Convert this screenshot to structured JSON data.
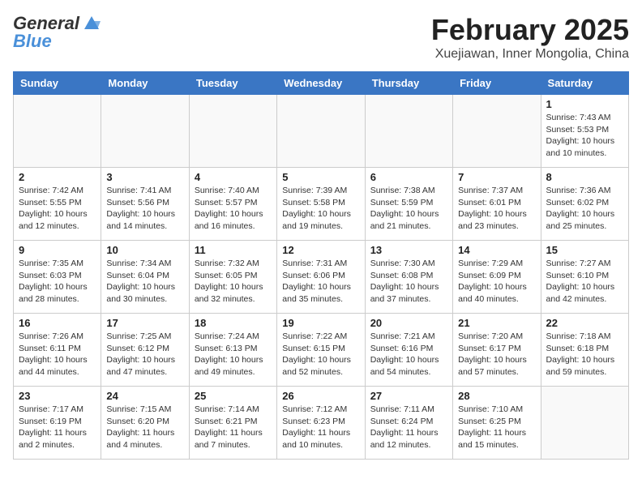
{
  "header": {
    "logo_general": "General",
    "logo_blue": "Blue",
    "title": "February 2025",
    "subtitle": "Xuejiawan, Inner Mongolia, China"
  },
  "weekdays": [
    "Sunday",
    "Monday",
    "Tuesday",
    "Wednesday",
    "Thursday",
    "Friday",
    "Saturday"
  ],
  "days": [
    {
      "num": "",
      "info": ""
    },
    {
      "num": "",
      "info": ""
    },
    {
      "num": "",
      "info": ""
    },
    {
      "num": "",
      "info": ""
    },
    {
      "num": "",
      "info": ""
    },
    {
      "num": "",
      "info": ""
    },
    {
      "num": "1",
      "info": "Sunrise: 7:43 AM\nSunset: 5:53 PM\nDaylight: 10 hours and 10 minutes."
    }
  ],
  "week2": [
    {
      "num": "2",
      "info": "Sunrise: 7:42 AM\nSunset: 5:55 PM\nDaylight: 10 hours and 12 minutes."
    },
    {
      "num": "3",
      "info": "Sunrise: 7:41 AM\nSunset: 5:56 PM\nDaylight: 10 hours and 14 minutes."
    },
    {
      "num": "4",
      "info": "Sunrise: 7:40 AM\nSunset: 5:57 PM\nDaylight: 10 hours and 16 minutes."
    },
    {
      "num": "5",
      "info": "Sunrise: 7:39 AM\nSunset: 5:58 PM\nDaylight: 10 hours and 19 minutes."
    },
    {
      "num": "6",
      "info": "Sunrise: 7:38 AM\nSunset: 5:59 PM\nDaylight: 10 hours and 21 minutes."
    },
    {
      "num": "7",
      "info": "Sunrise: 7:37 AM\nSunset: 6:01 PM\nDaylight: 10 hours and 23 minutes."
    },
    {
      "num": "8",
      "info": "Sunrise: 7:36 AM\nSunset: 6:02 PM\nDaylight: 10 hours and 25 minutes."
    }
  ],
  "week3": [
    {
      "num": "9",
      "info": "Sunrise: 7:35 AM\nSunset: 6:03 PM\nDaylight: 10 hours and 28 minutes."
    },
    {
      "num": "10",
      "info": "Sunrise: 7:34 AM\nSunset: 6:04 PM\nDaylight: 10 hours and 30 minutes."
    },
    {
      "num": "11",
      "info": "Sunrise: 7:32 AM\nSunset: 6:05 PM\nDaylight: 10 hours and 32 minutes."
    },
    {
      "num": "12",
      "info": "Sunrise: 7:31 AM\nSunset: 6:06 PM\nDaylight: 10 hours and 35 minutes."
    },
    {
      "num": "13",
      "info": "Sunrise: 7:30 AM\nSunset: 6:08 PM\nDaylight: 10 hours and 37 minutes."
    },
    {
      "num": "14",
      "info": "Sunrise: 7:29 AM\nSunset: 6:09 PM\nDaylight: 10 hours and 40 minutes."
    },
    {
      "num": "15",
      "info": "Sunrise: 7:27 AM\nSunset: 6:10 PM\nDaylight: 10 hours and 42 minutes."
    }
  ],
  "week4": [
    {
      "num": "16",
      "info": "Sunrise: 7:26 AM\nSunset: 6:11 PM\nDaylight: 10 hours and 44 minutes."
    },
    {
      "num": "17",
      "info": "Sunrise: 7:25 AM\nSunset: 6:12 PM\nDaylight: 10 hours and 47 minutes."
    },
    {
      "num": "18",
      "info": "Sunrise: 7:24 AM\nSunset: 6:13 PM\nDaylight: 10 hours and 49 minutes."
    },
    {
      "num": "19",
      "info": "Sunrise: 7:22 AM\nSunset: 6:15 PM\nDaylight: 10 hours and 52 minutes."
    },
    {
      "num": "20",
      "info": "Sunrise: 7:21 AM\nSunset: 6:16 PM\nDaylight: 10 hours and 54 minutes."
    },
    {
      "num": "21",
      "info": "Sunrise: 7:20 AM\nSunset: 6:17 PM\nDaylight: 10 hours and 57 minutes."
    },
    {
      "num": "22",
      "info": "Sunrise: 7:18 AM\nSunset: 6:18 PM\nDaylight: 10 hours and 59 minutes."
    }
  ],
  "week5": [
    {
      "num": "23",
      "info": "Sunrise: 7:17 AM\nSunset: 6:19 PM\nDaylight: 11 hours and 2 minutes."
    },
    {
      "num": "24",
      "info": "Sunrise: 7:15 AM\nSunset: 6:20 PM\nDaylight: 11 hours and 4 minutes."
    },
    {
      "num": "25",
      "info": "Sunrise: 7:14 AM\nSunset: 6:21 PM\nDaylight: 11 hours and 7 minutes."
    },
    {
      "num": "26",
      "info": "Sunrise: 7:12 AM\nSunset: 6:23 PM\nDaylight: 11 hours and 10 minutes."
    },
    {
      "num": "27",
      "info": "Sunrise: 7:11 AM\nSunset: 6:24 PM\nDaylight: 11 hours and 12 minutes."
    },
    {
      "num": "28",
      "info": "Sunrise: 7:10 AM\nSunset: 6:25 PM\nDaylight: 11 hours and 15 minutes."
    },
    {
      "num": "",
      "info": ""
    }
  ]
}
